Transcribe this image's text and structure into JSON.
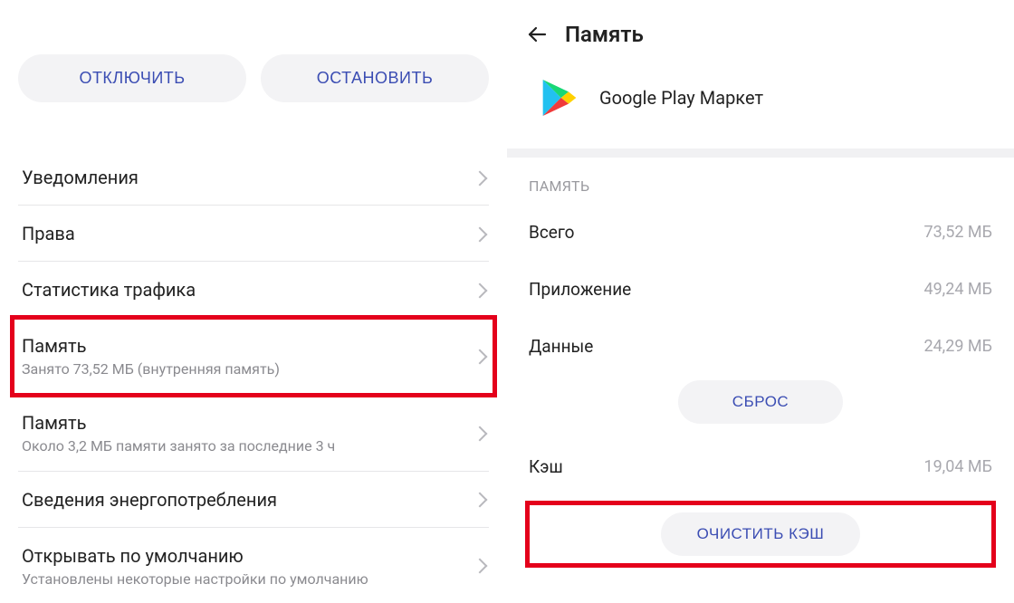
{
  "left": {
    "disable_btn": "ОТКЛЮЧИТЬ",
    "stop_btn": "ОСТАНОВИТЬ",
    "rows": {
      "notifications": "Уведомления",
      "permissions": "Права",
      "traffic": "Статистика трафика",
      "storage_title": "Память",
      "storage_sub": "Занято 73,52 МБ (внутренняя память)",
      "memory_title": "Память",
      "memory_sub": "Около 3,2 МБ памяти занято за последние 3 ч",
      "power": "Сведения энергопотребления",
      "defaults_title": "Открывать по умолчанию",
      "defaults_sub": "Установлены некоторые настройки по умолчанию"
    }
  },
  "right": {
    "header": "Память",
    "app_name": "Google Play Маркет",
    "section": "ПАМЯТЬ",
    "total_label": "Всего",
    "total_val": "73,52 МБ",
    "app_label": "Приложение",
    "app_val": "49,24 МБ",
    "data_label": "Данные",
    "data_val": "24,29 МБ",
    "reset_btn": "СБРОС",
    "cache_label": "Кэш",
    "cache_val": "19,04 МБ",
    "clear_cache_btn": "ОЧИСТИТЬ КЭШ"
  }
}
